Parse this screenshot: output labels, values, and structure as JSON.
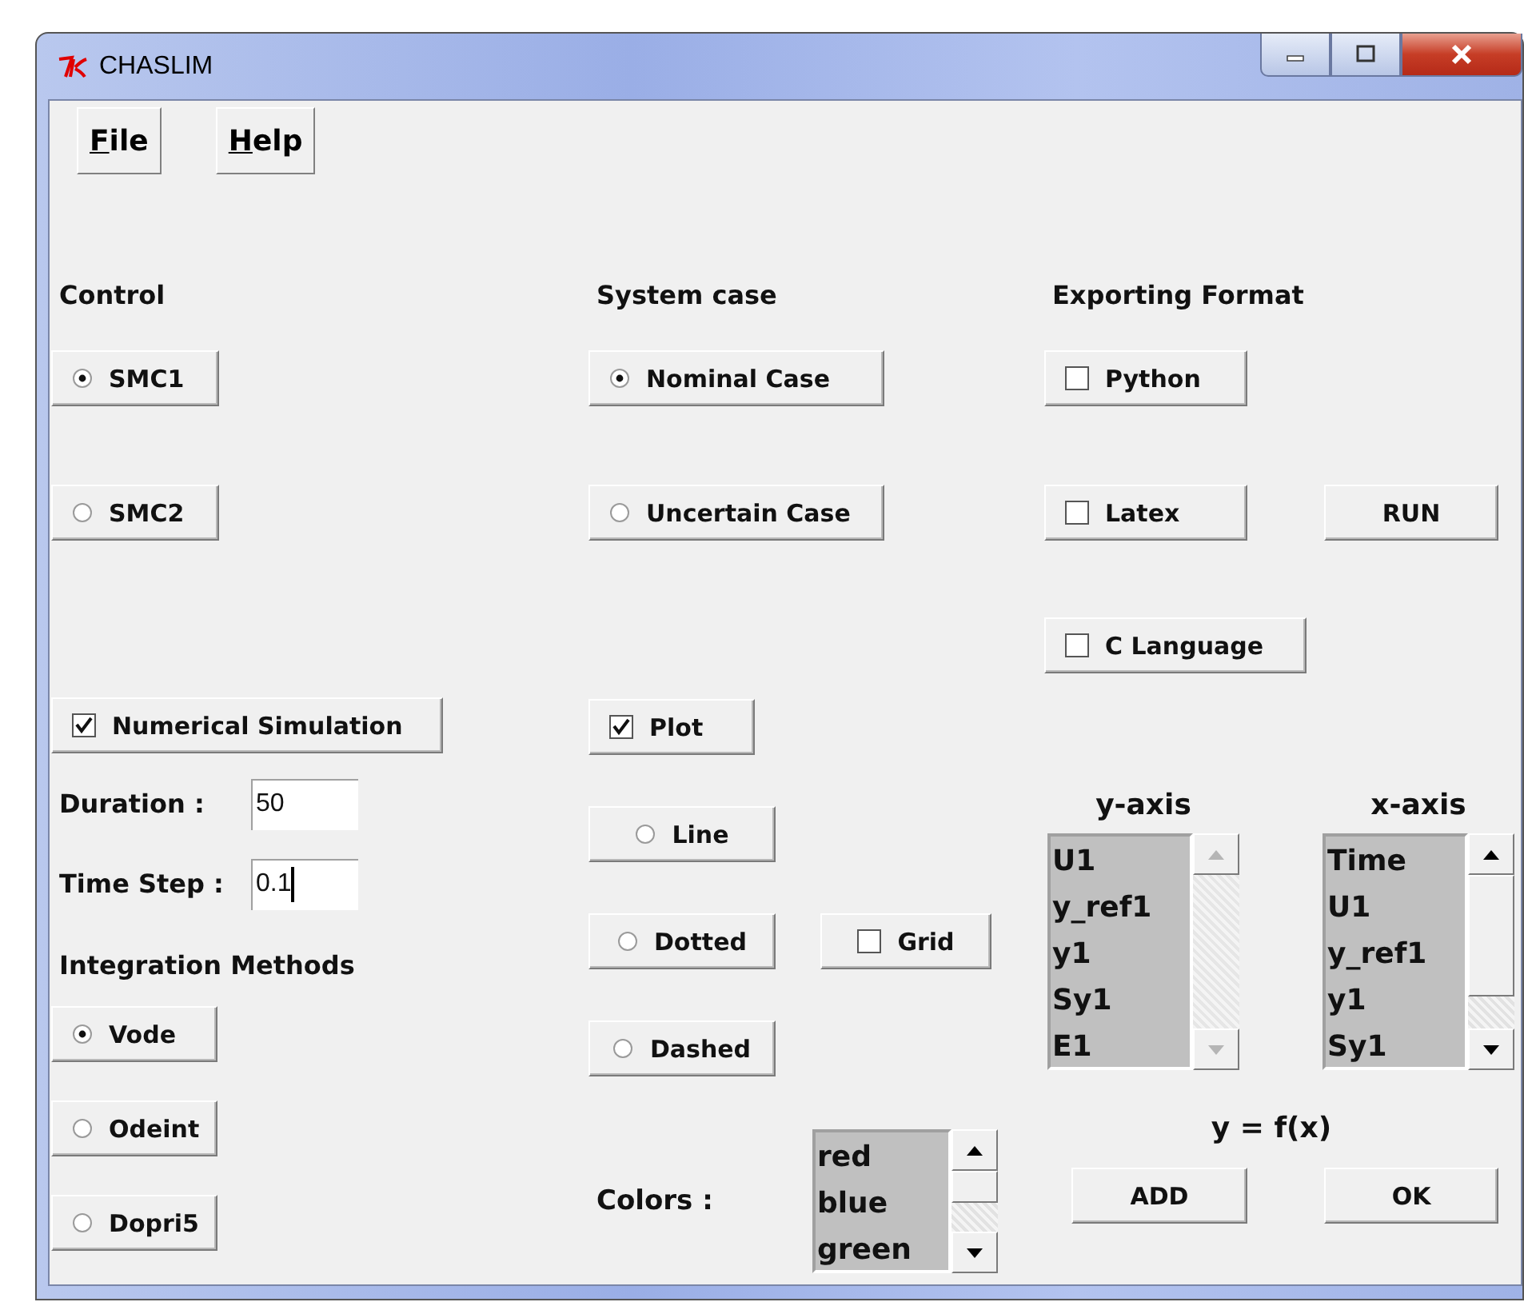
{
  "window": {
    "title": "CHASLIM"
  },
  "menu": [
    {
      "label": "File"
    },
    {
      "label": "Help"
    }
  ],
  "control": {
    "label": "Control",
    "options": [
      {
        "label": "SMC1",
        "selected": true
      },
      {
        "label": "SMC2",
        "selected": false
      }
    ]
  },
  "system_case": {
    "label": "System case",
    "options": [
      {
        "label": "Nominal Case",
        "selected": true
      },
      {
        "label": "Uncertain Case",
        "selected": false
      }
    ]
  },
  "exporting_format": {
    "label": "Exporting Format",
    "options": [
      {
        "label": "Python",
        "checked": false
      },
      {
        "label": "Latex",
        "checked": false
      },
      {
        "label": "C Language",
        "checked": false
      }
    ]
  },
  "run_button": "RUN",
  "numerical_simulation": {
    "label": "Numerical Simulation",
    "checked": true
  },
  "duration": {
    "label": "Duration :",
    "value": "50",
    "focused": false
  },
  "time_step": {
    "label": "Time Step :",
    "value": "0.1",
    "focused": true
  },
  "integration_methods": {
    "label": "Integration Methods",
    "options": [
      {
        "label": "Vode",
        "selected": true
      },
      {
        "label": "Odeint",
        "selected": false
      },
      {
        "label": "Dopri5",
        "selected": false
      }
    ]
  },
  "plot": {
    "label": "Plot",
    "checked": true
  },
  "line_style": [
    {
      "label": "Line",
      "selected": false
    },
    {
      "label": "Dotted",
      "selected": false
    },
    {
      "label": "Dashed",
      "selected": false
    }
  ],
  "grid": {
    "label": "Grid",
    "checked": false
  },
  "colors": {
    "label": "Colors :",
    "items": [
      "red",
      "blue",
      "green"
    ]
  },
  "y_axis": {
    "label": "y-axis",
    "items": [
      "U1",
      "y_ref1",
      "y1",
      "Sy1",
      "E1"
    ],
    "scroll_disabled": true
  },
  "x_axis": {
    "label": "x-axis",
    "items": [
      "Time",
      "U1",
      "y_ref1",
      "y1",
      "Sy1"
    ],
    "scroll_disabled": false
  },
  "formula": "y = f(x)",
  "buttons": [
    "ADD",
    "OK"
  ]
}
